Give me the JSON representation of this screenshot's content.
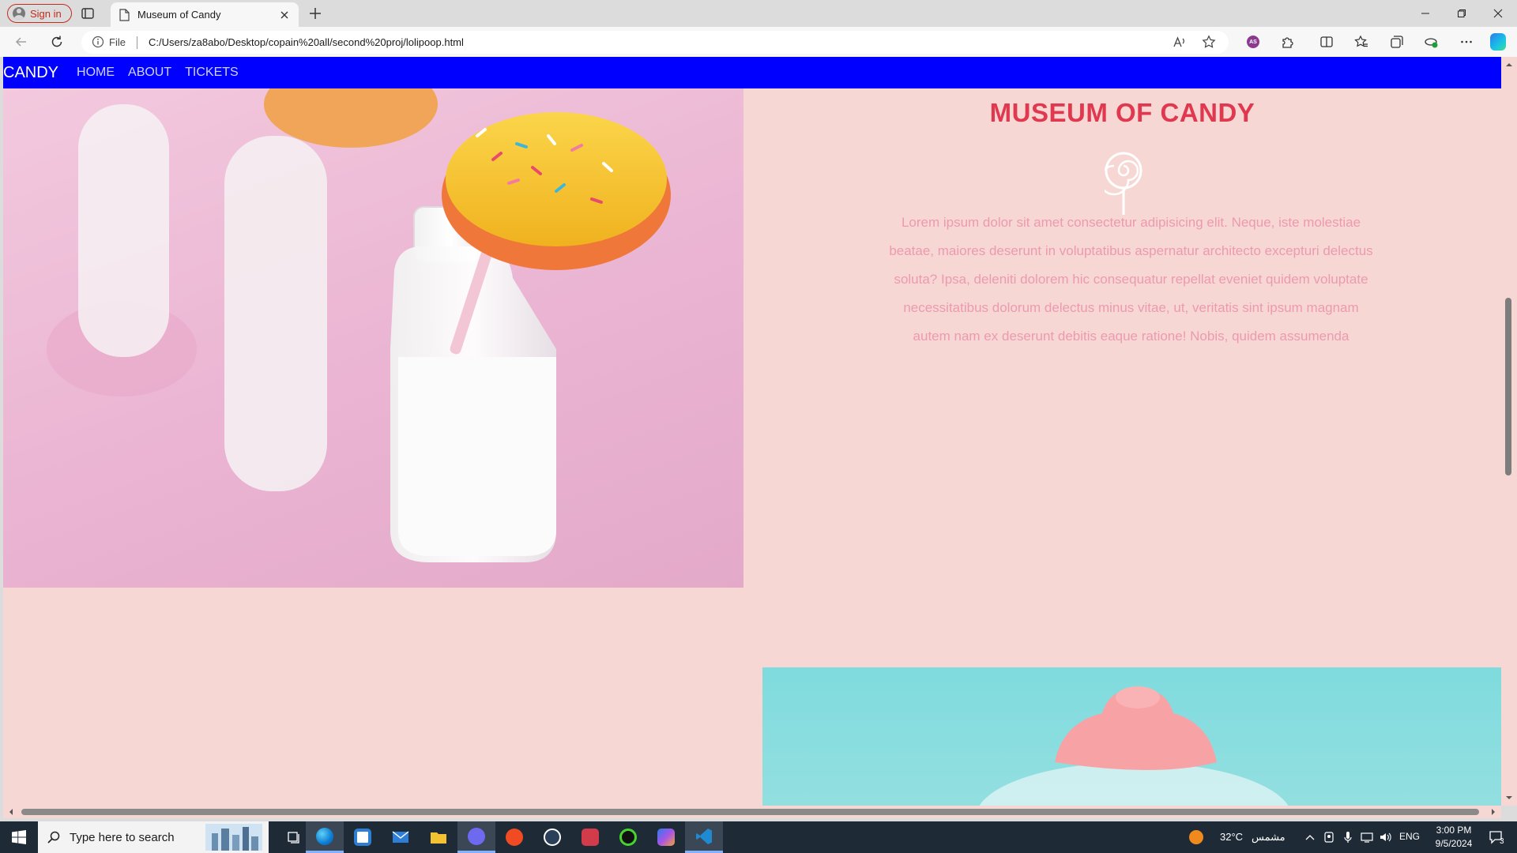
{
  "browser": {
    "signin_label": "Sign in",
    "tab_title": "Museum of Candy",
    "address": {
      "scheme_label": "File",
      "url": "C:/Users/za8abo/Desktop/copain%20all/second%20proj/lolipoop.html"
    },
    "profile_badge": "AS"
  },
  "page": {
    "nav": {
      "brand": "CANDY",
      "links": [
        "HOME",
        "ABOUT",
        "TICKETS"
      ]
    },
    "hero": {
      "title": "MUSEUM OF CANDY",
      "icon": "lollipop-icon",
      "body": "Lorem ipsum dolor sit amet consectetur adipisicing elit. Neque, iste molestiae beatae, maiores deserunt in voluptatibus aspernatur architecto excepturi delectus soluta? Ipsa, deleniti dolorem hic consequatur repellat eveniet quidem voluptate necessitatibus dolorum delectus minus vitae, ut, veritatis sint ipsum magnam autem nam ex deserunt debitis eaque ratione! Nobis, quidem assumenda"
    },
    "colors": {
      "navbar": "#0000ff",
      "background": "#f7d7d3",
      "title": "#e0384f",
      "body_text": "#ec9ab0"
    }
  },
  "taskbar": {
    "search_placeholder": "Type here to search",
    "weather": {
      "temperature": "32°C",
      "condition": "مشمس"
    },
    "language": "ENG",
    "time": "3:00 PM",
    "date": "9/5/2024",
    "notification_count": "3"
  }
}
